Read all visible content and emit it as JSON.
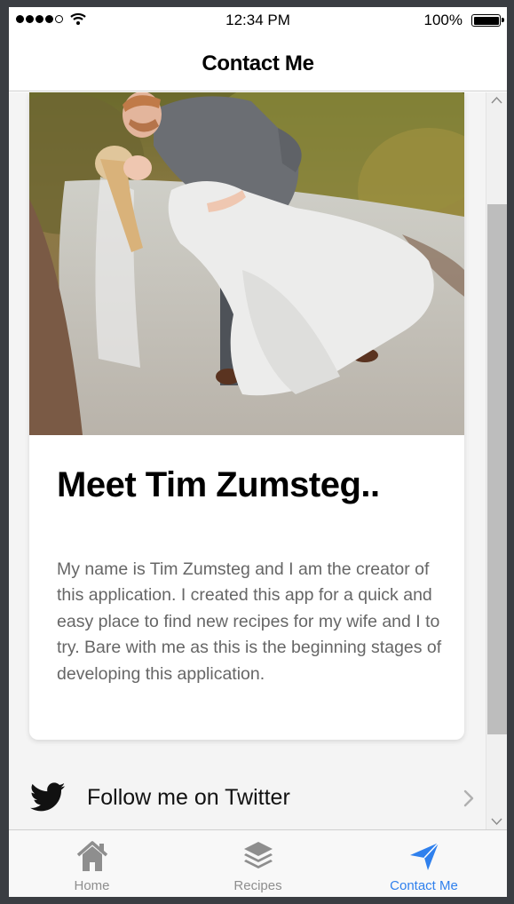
{
  "status_bar": {
    "time": "12:34 PM",
    "battery": "100%"
  },
  "header": {
    "title": "Contact Me"
  },
  "card": {
    "photo_icon": "wedding-photo",
    "title": "Meet Tim Zumsteg..",
    "body": "My name is Tim Zumsteg and I am the creator of this application. I created this app for a quick and easy place to find new recipes for my wife and I to try. Bare with me as this is the beginning stages of developing this application."
  },
  "links": [
    {
      "label": "Follow me on Twitter",
      "icon": "twitter-icon"
    }
  ],
  "tabbar": {
    "tabs": [
      {
        "label": "Home",
        "icon": "home-icon"
      },
      {
        "label": "Recipes",
        "icon": "layers-icon"
      },
      {
        "label": "Contact Me",
        "icon": "send-icon",
        "active": true
      }
    ]
  },
  "colors": {
    "active_tab": "#2f80ed",
    "inactive_tab": "#8e8e8e",
    "body_text": "#666666"
  }
}
